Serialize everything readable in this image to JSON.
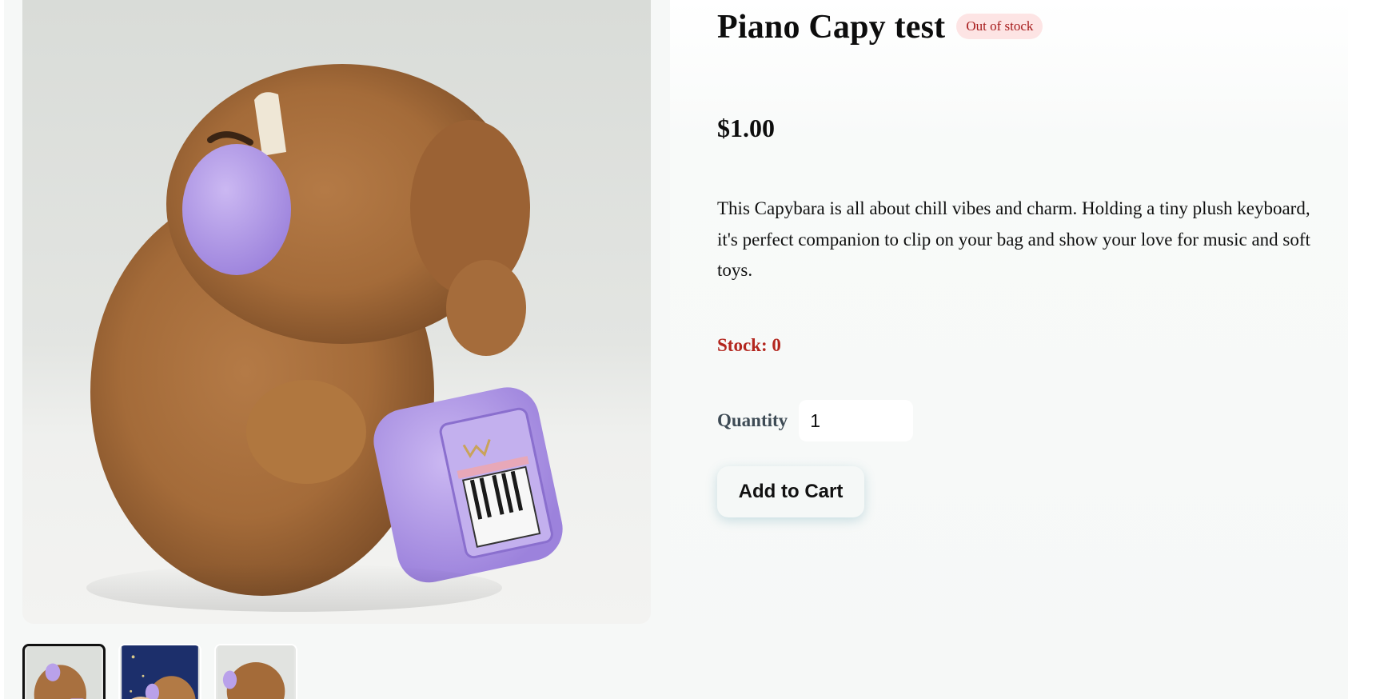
{
  "product": {
    "title": "Piano Capy test",
    "stock_badge": "Out of stock",
    "price": "$1.00",
    "description": "This Capybara is all about chill vibes and charm. Holding a tiny plush keyboard, it's perfect companion to clip on your bag and show your love for music and soft toys.",
    "stock_text": "Stock: 0",
    "quantity_label": "Quantity",
    "quantity_value": "1",
    "add_to_cart_label": "Add to Cart"
  },
  "gallery": {
    "main_image": "capybara-plush-with-headphones-and-keyboard",
    "thumbnails": [
      {
        "image": "capybara-side-view",
        "active": true
      },
      {
        "image": "capybara-on-blue-background",
        "active": false
      },
      {
        "image": "capybara-back-view",
        "active": false
      }
    ]
  },
  "colors": {
    "badge_bg": "#fde4e4",
    "badge_text": "#a61b1b",
    "stock_text": "#b3261e",
    "plush_brown": "#a8703f",
    "plush_lavender": "#b9a1ea"
  }
}
